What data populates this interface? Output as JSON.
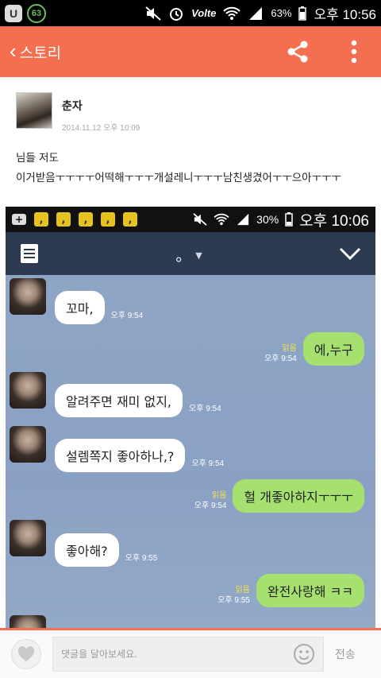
{
  "status_bar": {
    "app_letter": "U",
    "badge": "63",
    "network": "Volte",
    "battery": "63%",
    "time": "오후 10:56"
  },
  "app_bar": {
    "back_label": "스토리",
    "icons": [
      "share-icon",
      "overflow-menu-icon"
    ]
  },
  "post": {
    "author": "춘자",
    "date": "2014.11.12 오후 10:09",
    "lines": [
      "님들 저도",
      "이거받음ㅜㅜㅜㅜ어떡해ㅜㅜㅜ개설레니ㅜㅜㅜ남친생겼어ㅜㅜ으아ㅜㅜㅜ"
    ]
  },
  "screenshot": {
    "battery": "30%",
    "time": "오후 10:06",
    "title": "。",
    "messages": [
      {
        "side": "in",
        "text": "꼬마,",
        "time": "오후 9:54"
      },
      {
        "side": "out",
        "text": "에,누구",
        "read": "읽음",
        "time": "오후 9:54"
      },
      {
        "side": "in",
        "text": "알려주면 재미 없지,",
        "time": "오후 9:54"
      },
      {
        "side": "in",
        "text": "설렘쪽지 좋아하나,?",
        "time": "오후 9:54"
      },
      {
        "side": "out",
        "text": "헐 개좋아하지ㅜㅜㅜ",
        "read": "읽음",
        "time": "오후 9:54"
      },
      {
        "side": "in",
        "text": "좋아해?",
        "time": "오후 9:55"
      },
      {
        "side": "out",
        "text": "완전사랑해 ㅋㅋ",
        "read": "읽음",
        "time": "오후 9:55"
      }
    ]
  },
  "comment_bar": {
    "placeholder": "댓글을 달아보세요.",
    "send_label": "전송"
  },
  "colors": {
    "accent": "#f46f4f",
    "chat_background": "#8aa1c2",
    "bubble_out": "#a6e06e",
    "read_mark": "#f7e34a"
  }
}
